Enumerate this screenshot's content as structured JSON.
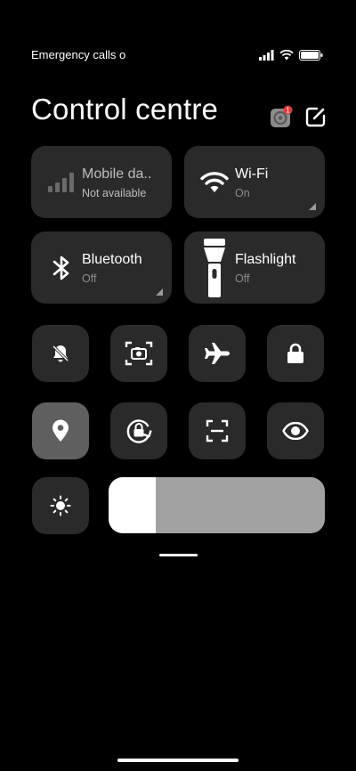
{
  "status_bar": {
    "carrier_text": "Emergency calls o",
    "icons": [
      "signal-icon",
      "wifi-icon",
      "battery-icon"
    ]
  },
  "header": {
    "title": "Control centre",
    "settings_badge": "1",
    "icons": [
      "settings-icon",
      "edit-icon"
    ]
  },
  "tiles": {
    "mobile_data": {
      "label": "Mobile da..",
      "status": "Not available",
      "icon": "cellular-signal-icon"
    },
    "wifi": {
      "label": "Wi-Fi",
      "status": "On",
      "icon": "wifi-icon"
    },
    "bluetooth": {
      "label": "Bluetooth",
      "status": "Off",
      "icon": "bluetooth-icon"
    },
    "flashlight": {
      "label": "Flashlight",
      "status": "Off",
      "icon": "flashlight-icon"
    }
  },
  "toggles": [
    {
      "name": "silent-mode",
      "icon": "bell-off-icon",
      "active": false
    },
    {
      "name": "screenshot",
      "icon": "screenshot-icon",
      "active": false
    },
    {
      "name": "airplane-mode",
      "icon": "airplane-icon",
      "active": false
    },
    {
      "name": "lock-screen",
      "icon": "lock-icon",
      "active": false
    },
    {
      "name": "location",
      "icon": "location-pin-icon",
      "active": true
    },
    {
      "name": "rotation-lock",
      "icon": "rotation-lock-icon",
      "active": false
    },
    {
      "name": "scanner",
      "icon": "scan-icon",
      "active": false
    },
    {
      "name": "reading-mode",
      "icon": "eye-icon",
      "active": false
    }
  ],
  "brightness": {
    "icon": "sun-icon",
    "level": 0.22
  },
  "colors": {
    "background": "#000000",
    "tile": "#2a2a2a",
    "tile_active": "#5f5f5f",
    "subtext": "#8c8c8c",
    "slider_track": "#a2a2a2",
    "slider_fill": "#ffffff",
    "badge": "#e53935"
  }
}
